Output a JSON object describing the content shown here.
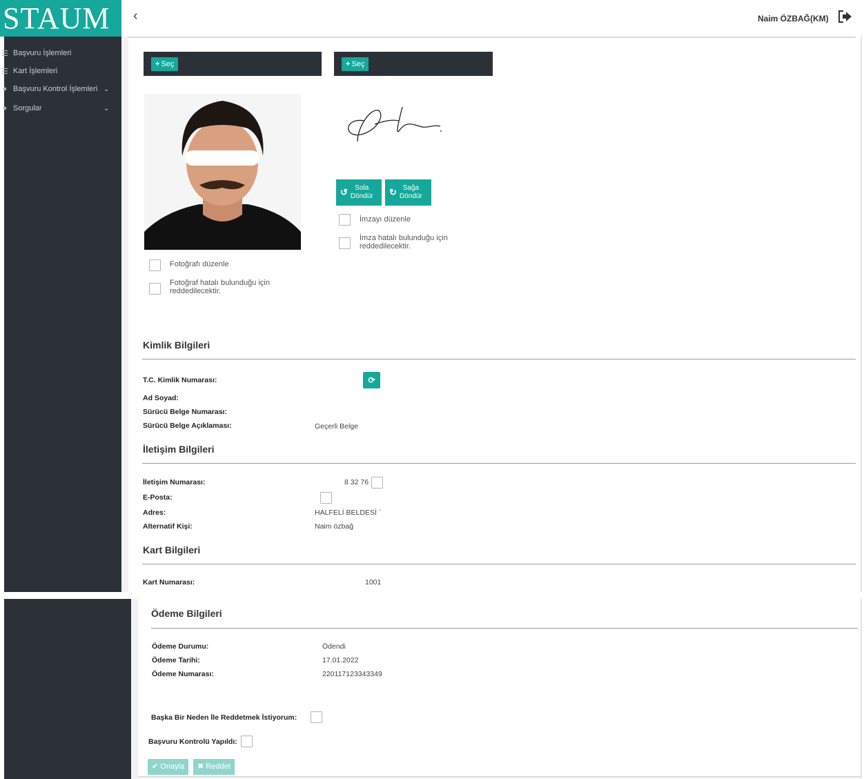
{
  "brand": {
    "name": "STAUM"
  },
  "header": {
    "user_name": "Naim ÖZBAĞ(KM)"
  },
  "sidebar": {
    "items": [
      {
        "label": "Başvuru İşlemleri"
      },
      {
        "label": "Kart İşlemleri"
      },
      {
        "label": "Başvuru Kontrol İşlemleri"
      },
      {
        "label": "Sorgular"
      }
    ]
  },
  "uploads": {
    "photo_select": "Seç",
    "signature_select": "Seç"
  },
  "signature_tools": {
    "rotate_left_1": "Sola",
    "rotate_left_2": "Döndür",
    "rotate_right_1": "Sağa",
    "rotate_right_2": "Döndür",
    "edit_signature": "İmzayı düzenle",
    "reject_signature_1": "İmza hatalı bulunduğu için",
    "reject_signature_2": "reddedilecektir."
  },
  "photo_tools": {
    "edit_photo": "Fotoğrafı düzenle",
    "reject_photo_1": "Fotoğraf hatalı bulunduğu için",
    "reject_photo_2": "reddedilecektir."
  },
  "identity": {
    "title": "Kimlik Bilgileri",
    "tc_label": "T.C. Kimlik Numarası:",
    "name_label": "Ad Soyad:",
    "license_no_label": "Sürücü Belge Numarası:",
    "license_desc_label": "Sürücü Belge Açıklaması:",
    "license_desc_value": "Geçerli Belge"
  },
  "contact": {
    "title": "İletişim Bilgileri",
    "phone_label": "İletişim Numarası:",
    "phone_value": "8 32 76",
    "email_label": "E-Posta:",
    "address_label": "Adres:",
    "address_value": "HALFELİ BELDESİ `",
    "alt_person_label": "Alternatif Kişi:",
    "alt_person_value": "Naim özbağ"
  },
  "card": {
    "title": "Kart Bilgileri",
    "card_no_label": "Kart Numarası:",
    "card_no_value": "1001"
  },
  "payment": {
    "title": "Ödeme Bilgileri",
    "status_label": "Ödeme Durumu:",
    "status_value": "Ödendi",
    "date_label": "Ödeme Tarihi:",
    "date_value": "17.01.2022",
    "number_label": "Ödeme Numarası:",
    "number_value": "220117123343349"
  },
  "review": {
    "other_reason_label": "Başka Bir Neden İle Reddetmek İstiyorum:",
    "checked_label": "Başvuru Kontrolü Yapıldı:",
    "approve_label": "Onayla",
    "reject_label": "Reddet"
  },
  "colors": {
    "accent": "#16a89a",
    "sidebar": "#2c3138",
    "disabled_accent": "#8fd5cc"
  }
}
